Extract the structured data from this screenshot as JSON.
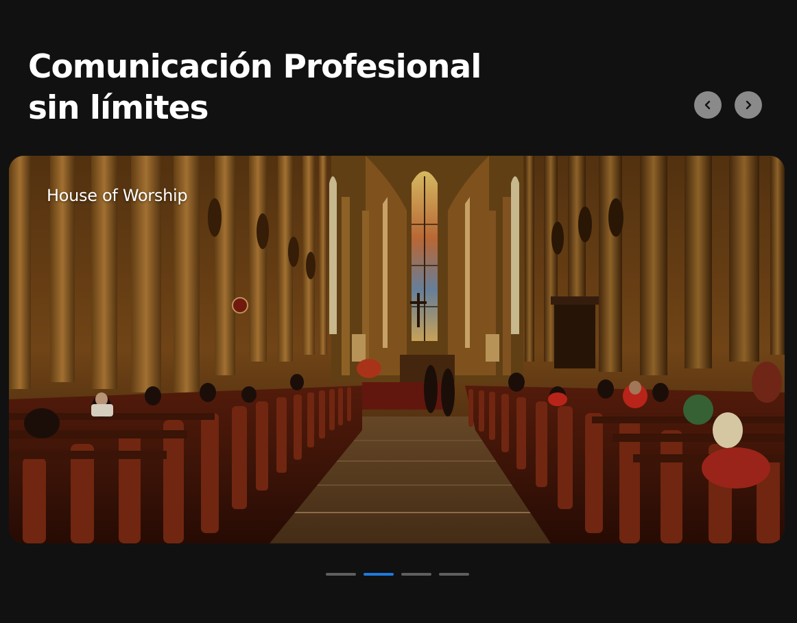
{
  "header": {
    "title_line1": "Comunicación Profesional",
    "title_line2": "sin límites"
  },
  "carousel": {
    "prev_icon": "chevron-left-icon",
    "next_icon": "chevron-right-icon",
    "slide": {
      "caption": "House of Worship"
    },
    "pagination": {
      "count": 4,
      "active_index": 1
    }
  },
  "colors": {
    "background": "#111111",
    "nav_button": "#8a8a8a",
    "active_dot": "#1f7ae0",
    "inactive_dot": "#5f5f5f"
  }
}
